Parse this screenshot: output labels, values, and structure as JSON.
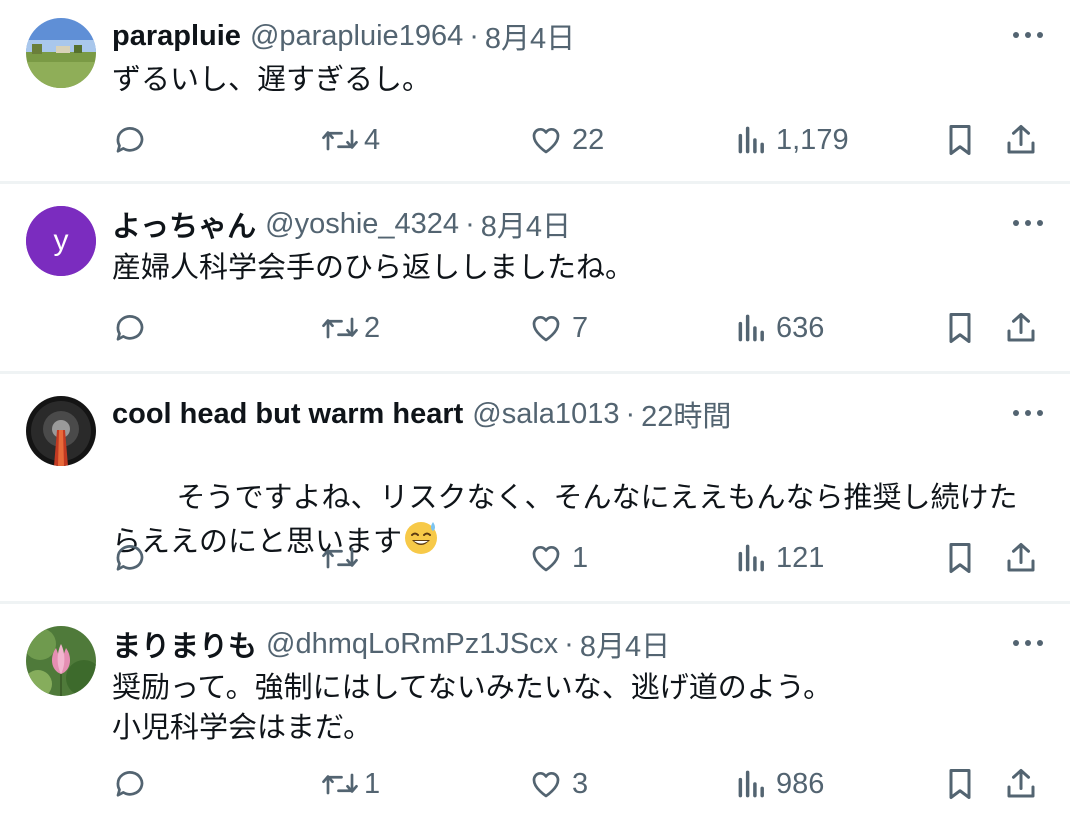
{
  "tweets": [
    {
      "name": "parapluie",
      "handle": "@parapluie1964",
      "separator": "·",
      "time": "8月4日",
      "text": "ずるいし、遅すぎるし。",
      "replies": "",
      "retweets": "4",
      "likes": "22",
      "views": "1,179",
      "avatar_icon": "landscape-photo-avatar"
    },
    {
      "name": "よっちゃん",
      "handle": "@yoshie_4324",
      "separator": "·",
      "time": "8月4日",
      "text": "産婦人科学会手のひら返ししましたね。",
      "replies": "",
      "retweets": "2",
      "likes": "7",
      "views": "636",
      "avatar_letter": "y",
      "avatar_color": "#7b2cbf"
    },
    {
      "name": "cool head but warm heart",
      "handle": "@sala1013",
      "separator": "·",
      "time": "22時間",
      "text": "そうですよね、リスクなく、そんなにええもんなら推奨し続けたらええのにと思います",
      "emoji": "sweat-smile-emoji",
      "replies": "",
      "retweets": "",
      "likes": "1",
      "views": "121",
      "avatar_icon": "tower-photo-avatar"
    },
    {
      "name": "まりまりも",
      "handle": "@dhmqLoRmPz1JScx",
      "separator": "·",
      "time": "8月4日",
      "text": "奨励って。強制にはしてないみたいな、逃げ道のよう。\n小児科学会はまだ。",
      "replies": "",
      "retweets": "1",
      "likes": "3",
      "views": "986",
      "avatar_icon": "lotus-photo-avatar"
    }
  ],
  "colors": {
    "text": "#0f1419",
    "muted": "#536471",
    "divider": "#eff3f4"
  },
  "icons": [
    "reply-icon",
    "retweet-icon",
    "like-icon",
    "views-icon",
    "bookmark-icon",
    "share-icon",
    "more-icon"
  ]
}
